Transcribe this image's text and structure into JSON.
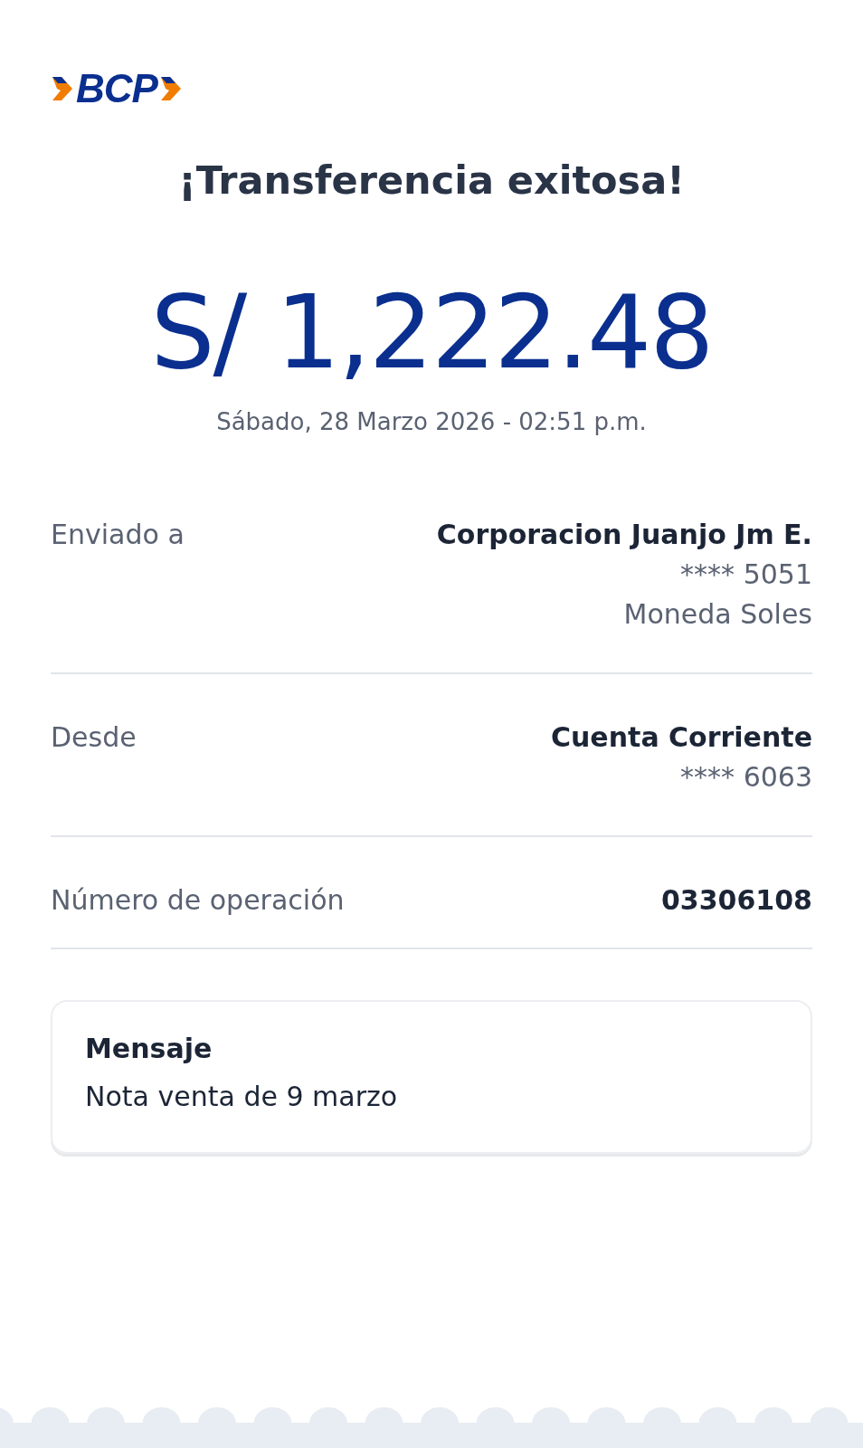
{
  "logo": {
    "text": "BCP"
  },
  "title": "¡Transferencia exitosa!",
  "amount": "S/ 1,222.48",
  "datetime": "Sábado, 28 Marzo 2026 - 02:51 p.m.",
  "details": [
    {
      "label": "Enviado a",
      "values": [
        {
          "text": "Corporacion Juanjo Jm E.",
          "kind": "bold"
        },
        {
          "text": "**** 5051",
          "kind": "regular"
        },
        {
          "text": "Moneda Soles",
          "kind": "regular"
        }
      ]
    },
    {
      "label": "Desde",
      "values": [
        {
          "text": "Cuenta Corriente",
          "kind": "bold"
        },
        {
          "text": "**** 6063",
          "kind": "regular"
        }
      ]
    },
    {
      "label": "Número de operación",
      "values": [
        {
          "text": "03306108",
          "kind": "bold"
        }
      ]
    }
  ],
  "message": {
    "heading": "Mensaje",
    "text": "Nota venta de 9 marzo"
  }
}
